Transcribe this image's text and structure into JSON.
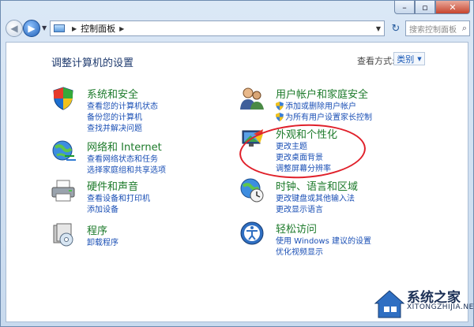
{
  "navbar": {
    "breadcrumb": "控制面板",
    "search_placeholder": "搜索控制面板"
  },
  "main": {
    "title": "调整计算机的设置",
    "view_by_label": "查看方式:",
    "view_by_value": "类别"
  },
  "categories": [
    {
      "title": "系统和安全",
      "icon": "shield-icon",
      "links": [
        "查看您的计算机状态",
        "备份您的计算机",
        "查找并解决问题"
      ]
    },
    {
      "title": "网络和 Internet",
      "icon": "network-icon",
      "links": [
        "查看网络状态和任务",
        "选择家庭组和共享选项"
      ]
    },
    {
      "title": "硬件和声音",
      "icon": "printer-icon",
      "links": [
        "查看设备和打印机",
        "添加设备"
      ]
    },
    {
      "title": "程序",
      "icon": "programs-icon",
      "links": [
        "卸载程序"
      ]
    },
    {
      "title": "用户帐户和家庭安全",
      "icon": "users-icon",
      "links": [
        "添加或删除用户帐户",
        "为所有用户设置家长控制"
      ]
    },
    {
      "title": "外观和个性化",
      "icon": "appearance-icon",
      "links": [
        "更改主题",
        "更改桌面背景",
        "调整屏幕分辨率"
      ]
    },
    {
      "title": "时钟、语言和区域",
      "icon": "globe-clock-icon",
      "links": [
        "更改键盘或其他输入法",
        "更改显示语言"
      ]
    },
    {
      "title": "轻松访问",
      "icon": "ease-of-access-icon",
      "links": [
        "使用 Windows 建议的设置",
        "优化视频显示"
      ]
    }
  ],
  "watermark": {
    "name": "系统之家",
    "url": "XITONGZHIJIA.NET"
  },
  "colors": {
    "category_title": "#1c7a2a",
    "link": "#1a4fb5",
    "annotation": "#e0202a"
  }
}
